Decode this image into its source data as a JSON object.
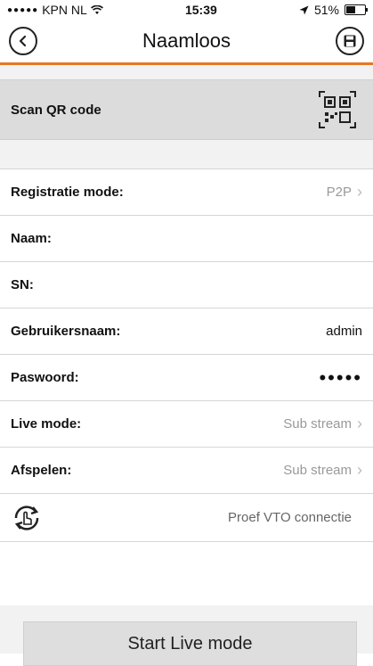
{
  "status_bar": {
    "carrier": "KPN NL",
    "time": "15:39",
    "battery": "51%",
    "battery_level": 0.51
  },
  "navbar": {
    "title": "Naamloos"
  },
  "qr": {
    "label": "Scan QR code"
  },
  "fields": {
    "registratie": {
      "label": "Registratie mode:",
      "value": "P2P"
    },
    "naam": {
      "label": "Naam:",
      "value": ""
    },
    "sn": {
      "label": "SN:",
      "value": ""
    },
    "gebruikersnaam": {
      "label": "Gebruikersnaam:",
      "value": "admin"
    },
    "paswoord": {
      "label": "Paswoord:",
      "value": "•••••"
    },
    "live_mode": {
      "label": "Live mode:",
      "value": "Sub stream"
    },
    "afspelen": {
      "label": "Afspelen:",
      "value": "Sub stream"
    }
  },
  "vto": {
    "label": "Proef VTO connectie"
  },
  "start_button": {
    "label": "Start Live mode"
  },
  "colors": {
    "accent": "#e87722"
  }
}
